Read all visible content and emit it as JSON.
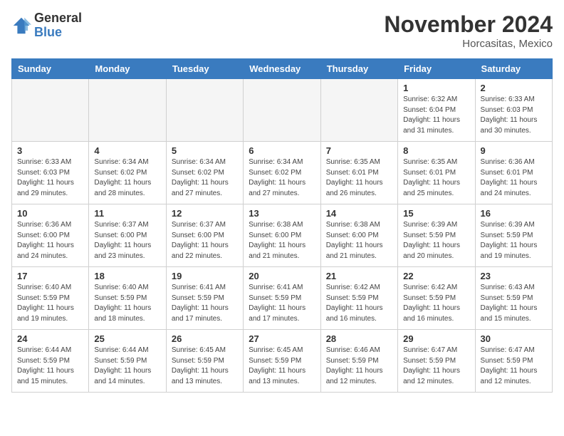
{
  "logo": {
    "general": "General",
    "blue": "Blue"
  },
  "header": {
    "month": "November 2024",
    "location": "Horcasitas, Mexico"
  },
  "days_of_week": [
    "Sunday",
    "Monday",
    "Tuesday",
    "Wednesday",
    "Thursday",
    "Friday",
    "Saturday"
  ],
  "weeks": [
    [
      {
        "day": "",
        "info": ""
      },
      {
        "day": "",
        "info": ""
      },
      {
        "day": "",
        "info": ""
      },
      {
        "day": "",
        "info": ""
      },
      {
        "day": "",
        "info": ""
      },
      {
        "day": "1",
        "info": "Sunrise: 6:32 AM\nSunset: 6:04 PM\nDaylight: 11 hours and 31 minutes."
      },
      {
        "day": "2",
        "info": "Sunrise: 6:33 AM\nSunset: 6:03 PM\nDaylight: 11 hours and 30 minutes."
      }
    ],
    [
      {
        "day": "3",
        "info": "Sunrise: 6:33 AM\nSunset: 6:03 PM\nDaylight: 11 hours and 29 minutes."
      },
      {
        "day": "4",
        "info": "Sunrise: 6:34 AM\nSunset: 6:02 PM\nDaylight: 11 hours and 28 minutes."
      },
      {
        "day": "5",
        "info": "Sunrise: 6:34 AM\nSunset: 6:02 PM\nDaylight: 11 hours and 27 minutes."
      },
      {
        "day": "6",
        "info": "Sunrise: 6:34 AM\nSunset: 6:02 PM\nDaylight: 11 hours and 27 minutes."
      },
      {
        "day": "7",
        "info": "Sunrise: 6:35 AM\nSunset: 6:01 PM\nDaylight: 11 hours and 26 minutes."
      },
      {
        "day": "8",
        "info": "Sunrise: 6:35 AM\nSunset: 6:01 PM\nDaylight: 11 hours and 25 minutes."
      },
      {
        "day": "9",
        "info": "Sunrise: 6:36 AM\nSunset: 6:01 PM\nDaylight: 11 hours and 24 minutes."
      }
    ],
    [
      {
        "day": "10",
        "info": "Sunrise: 6:36 AM\nSunset: 6:00 PM\nDaylight: 11 hours and 24 minutes."
      },
      {
        "day": "11",
        "info": "Sunrise: 6:37 AM\nSunset: 6:00 PM\nDaylight: 11 hours and 23 minutes."
      },
      {
        "day": "12",
        "info": "Sunrise: 6:37 AM\nSunset: 6:00 PM\nDaylight: 11 hours and 22 minutes."
      },
      {
        "day": "13",
        "info": "Sunrise: 6:38 AM\nSunset: 6:00 PM\nDaylight: 11 hours and 21 minutes."
      },
      {
        "day": "14",
        "info": "Sunrise: 6:38 AM\nSunset: 6:00 PM\nDaylight: 11 hours and 21 minutes."
      },
      {
        "day": "15",
        "info": "Sunrise: 6:39 AM\nSunset: 5:59 PM\nDaylight: 11 hours and 20 minutes."
      },
      {
        "day": "16",
        "info": "Sunrise: 6:39 AM\nSunset: 5:59 PM\nDaylight: 11 hours and 19 minutes."
      }
    ],
    [
      {
        "day": "17",
        "info": "Sunrise: 6:40 AM\nSunset: 5:59 PM\nDaylight: 11 hours and 19 minutes."
      },
      {
        "day": "18",
        "info": "Sunrise: 6:40 AM\nSunset: 5:59 PM\nDaylight: 11 hours and 18 minutes."
      },
      {
        "day": "19",
        "info": "Sunrise: 6:41 AM\nSunset: 5:59 PM\nDaylight: 11 hours and 17 minutes."
      },
      {
        "day": "20",
        "info": "Sunrise: 6:41 AM\nSunset: 5:59 PM\nDaylight: 11 hours and 17 minutes."
      },
      {
        "day": "21",
        "info": "Sunrise: 6:42 AM\nSunset: 5:59 PM\nDaylight: 11 hours and 16 minutes."
      },
      {
        "day": "22",
        "info": "Sunrise: 6:42 AM\nSunset: 5:59 PM\nDaylight: 11 hours and 16 minutes."
      },
      {
        "day": "23",
        "info": "Sunrise: 6:43 AM\nSunset: 5:59 PM\nDaylight: 11 hours and 15 minutes."
      }
    ],
    [
      {
        "day": "24",
        "info": "Sunrise: 6:44 AM\nSunset: 5:59 PM\nDaylight: 11 hours and 15 minutes."
      },
      {
        "day": "25",
        "info": "Sunrise: 6:44 AM\nSunset: 5:59 PM\nDaylight: 11 hours and 14 minutes."
      },
      {
        "day": "26",
        "info": "Sunrise: 6:45 AM\nSunset: 5:59 PM\nDaylight: 11 hours and 13 minutes."
      },
      {
        "day": "27",
        "info": "Sunrise: 6:45 AM\nSunset: 5:59 PM\nDaylight: 11 hours and 13 minutes."
      },
      {
        "day": "28",
        "info": "Sunrise: 6:46 AM\nSunset: 5:59 PM\nDaylight: 11 hours and 12 minutes."
      },
      {
        "day": "29",
        "info": "Sunrise: 6:47 AM\nSunset: 5:59 PM\nDaylight: 11 hours and 12 minutes."
      },
      {
        "day": "30",
        "info": "Sunrise: 6:47 AM\nSunset: 5:59 PM\nDaylight: 11 hours and 12 minutes."
      }
    ]
  ]
}
